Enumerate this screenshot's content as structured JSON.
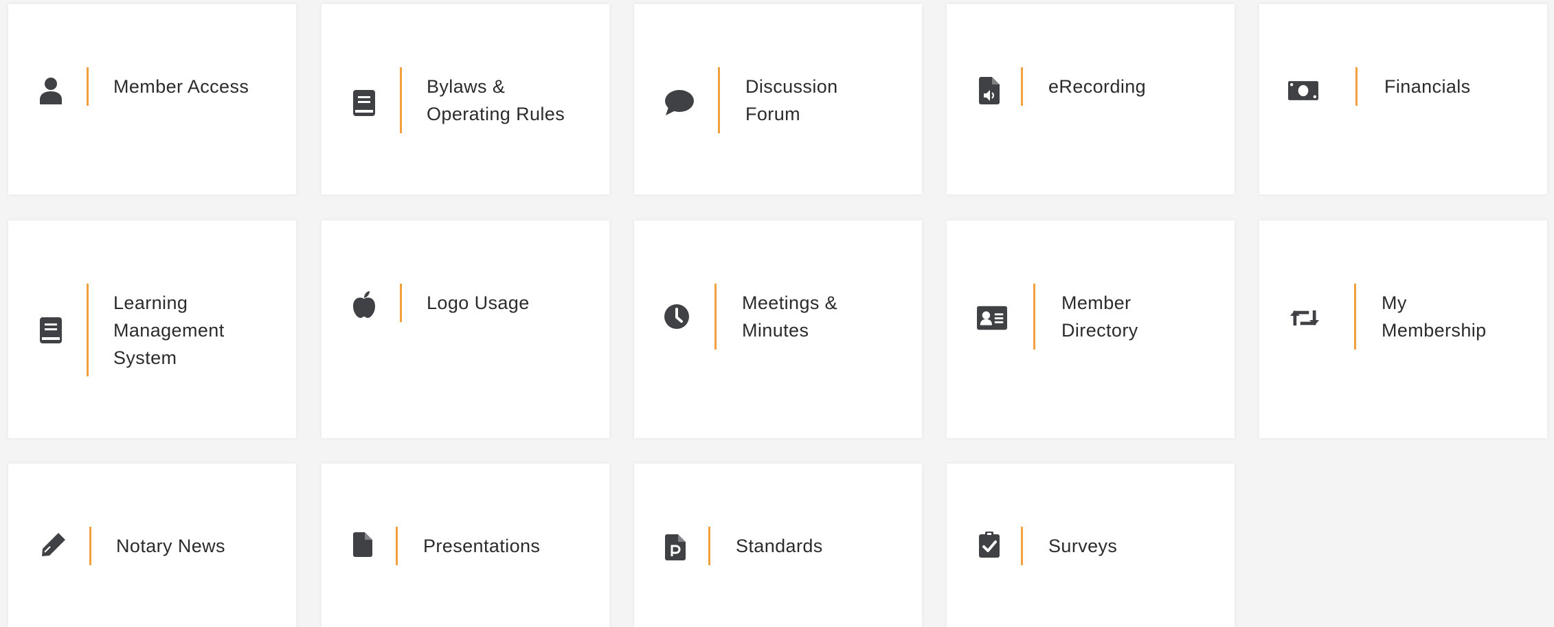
{
  "accent_color": "#f2a03d",
  "icon_color": "#3f4144",
  "tiles": [
    {
      "label": "Member Access",
      "icon": "user-icon"
    },
    {
      "label": "Bylaws &\nOperating Rules",
      "icon": "book-icon"
    },
    {
      "label": "Discussion\nForum",
      "icon": "comment-icon"
    },
    {
      "label": "eRecording",
      "icon": "file-audio-icon"
    },
    {
      "label": "Financials",
      "icon": "money-bill-icon"
    },
    {
      "label": "Learning\nManagement\nSystem",
      "icon": "book-icon"
    },
    {
      "label": "Logo Usage",
      "icon": "apple-icon"
    },
    {
      "label": "Meetings &\nMinutes",
      "icon": "clock-icon"
    },
    {
      "label": "Member\nDirectory",
      "icon": "id-card-icon"
    },
    {
      "label": "My\nMembership",
      "icon": "retweet-icon"
    },
    {
      "label": "Notary News",
      "icon": "pen-icon"
    },
    {
      "label": "Presentations",
      "icon": "file-icon"
    },
    {
      "label": "Standards",
      "icon": "file-p-icon"
    },
    {
      "label": "Surveys",
      "icon": "clipboard-check-icon"
    }
  ]
}
